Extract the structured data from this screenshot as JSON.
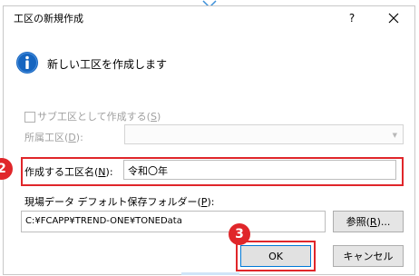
{
  "dialog": {
    "title": "工区の新規作成",
    "help_label": "?",
    "close_label": "×",
    "message": "新しい工区を作成します"
  },
  "sub_area": {
    "label_text": "サブ工区として作成する(",
    "label_key": "S",
    "label_end": ")",
    "checked": false,
    "enabled": false
  },
  "parent_area": {
    "label_text": "所属工区(",
    "label_key": "D",
    "label_end": "):",
    "value": "",
    "enabled": false
  },
  "area_name": {
    "label_text": "作成する工区名(",
    "label_key": "N",
    "label_end": "):",
    "value": "令和〇年"
  },
  "folder": {
    "label_text": "現場データ デフォルト保存フォルダー(",
    "label_key": "P",
    "label_end": "):",
    "value": "C:¥FCAPP¥TREND-ONE¥TONEData"
  },
  "buttons": {
    "browse_text": "参照(",
    "browse_key": "R",
    "browse_end": ")...",
    "ok": "OK",
    "cancel": "キャンセル"
  },
  "markers": {
    "step2": "2",
    "step3": "3"
  },
  "colors": {
    "highlight": "#e0262a",
    "info_icon": "#1565c0",
    "focus_border": "#0078d7"
  }
}
